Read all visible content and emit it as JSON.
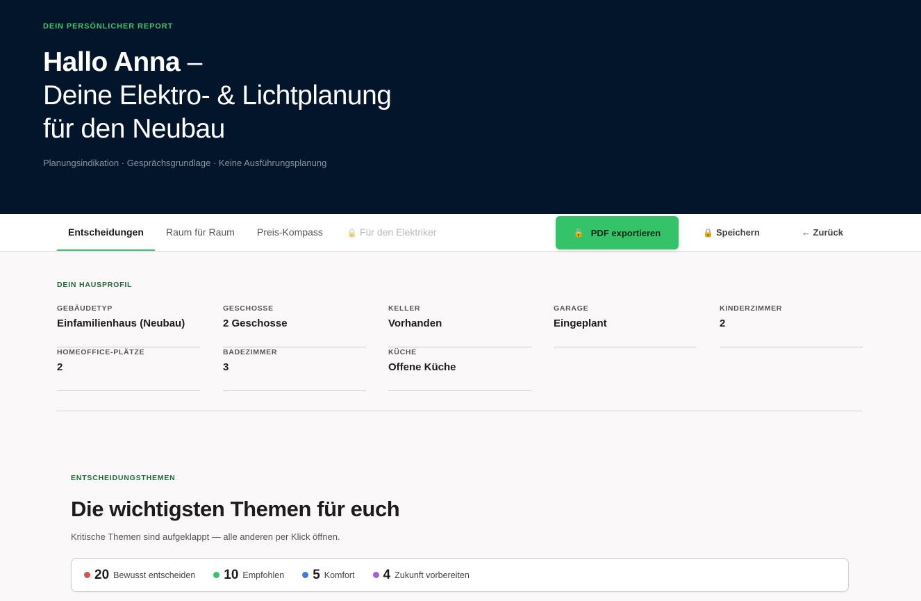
{
  "hero": {
    "eyebrow": "DEIN PERSÖNLICHER REPORT",
    "greeting_name": "Hallo Anna",
    "greeting_dash": " –",
    "title_line1": "Deine Elektro- & Lichtplanung",
    "title_line2": "für den Neubau",
    "subtitle": "Planungsindikation · Gesprächsgrundlage · Keine Ausführungsplanung"
  },
  "tabs": [
    {
      "label": "Entscheidungen",
      "active": true
    },
    {
      "label": "Raum für Raum"
    },
    {
      "label": "Preis-Kompass"
    },
    {
      "label": "Für den Elektriker",
      "locked": true
    }
  ],
  "actions": {
    "pdf_label": "PDF exportieren",
    "save_label": "Speichern",
    "back_label": "← Zurück"
  },
  "profile": {
    "section_label": "DEIN HAUSPROFIL",
    "items": [
      {
        "key": "GEBÄUDETYP",
        "value": "Einfamilienhaus (Neubau)"
      },
      {
        "key": "GESCHOSSE",
        "value": "2 Geschosse"
      },
      {
        "key": "KELLER",
        "value": "Vorhanden"
      },
      {
        "key": "GARAGE",
        "value": "Eingeplant"
      },
      {
        "key": "KINDERZIMMER",
        "value": "2"
      },
      {
        "key": "HOMEOFFICE-PLÄTZE",
        "value": "2"
      },
      {
        "key": "BADEZIMMER",
        "value": "3"
      },
      {
        "key": "KÜCHE",
        "value": "Offene Küche"
      }
    ]
  },
  "topics": {
    "section_label": "ENTSCHEIDUNGSTHEMEN",
    "title": "Die wichtigsten Themen für euch",
    "subtitle": "Kritische Themen sind aufgeklappt — alle anderen per Klick öffnen.",
    "stats": [
      {
        "count": "20",
        "label": "Bewusst entscheiden",
        "color": "#d9534f"
      },
      {
        "count": "10",
        "label": "Empfohlen",
        "color": "#34c368"
      },
      {
        "count": "5",
        "label": "Komfort",
        "color": "#3b7ddd"
      },
      {
        "count": "4",
        "label": "Zukunft vorbereiten",
        "color": "#a35ee0"
      }
    ]
  },
  "colors": {
    "accent": "#34c368",
    "hero_bg": "#02152a",
    "label_green": "#1c6a36"
  }
}
